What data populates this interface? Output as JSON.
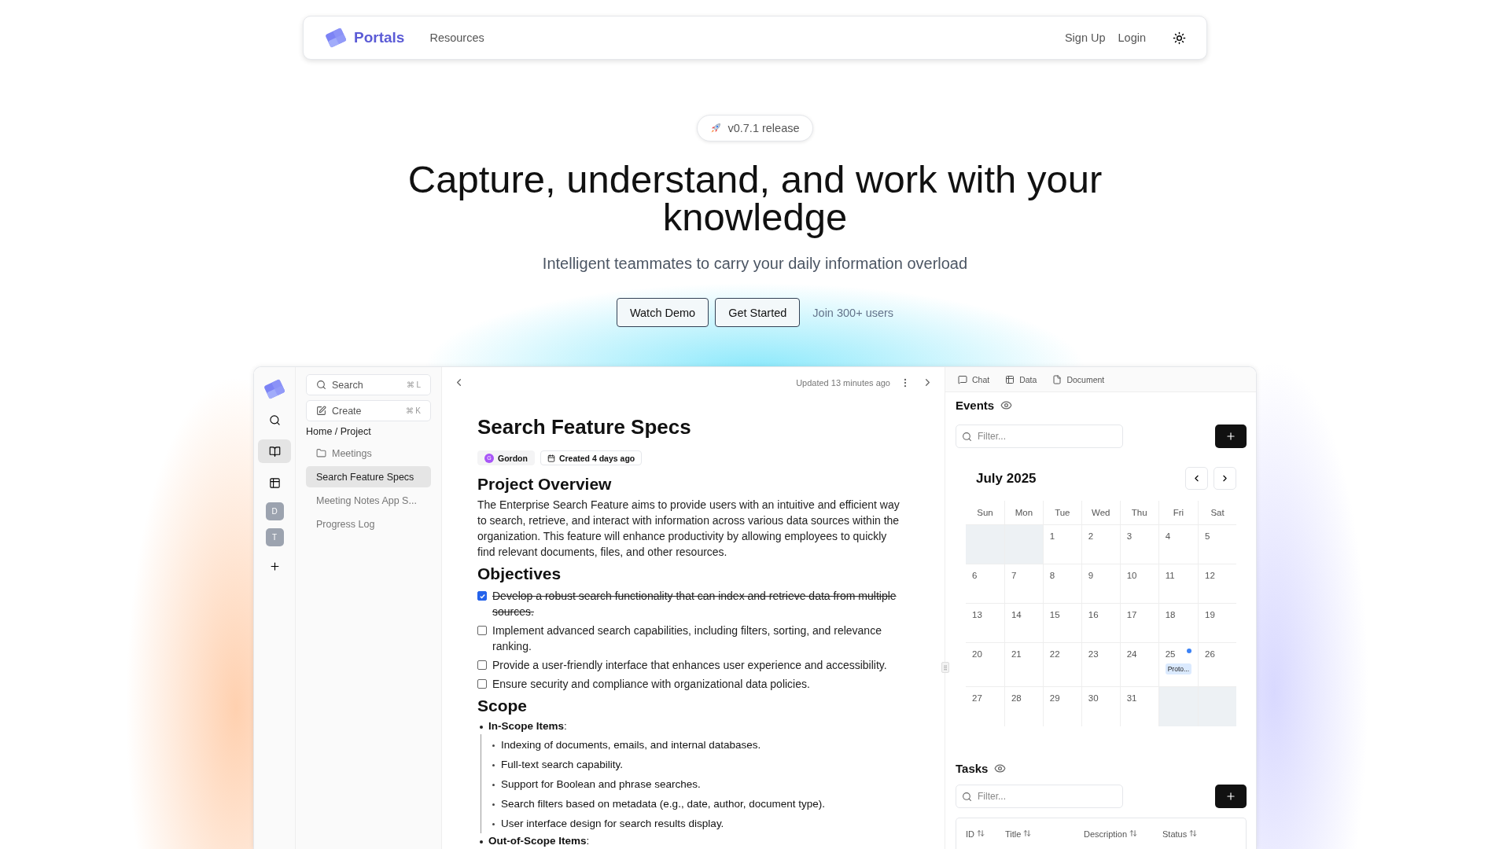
{
  "nav": {
    "brand": "Portals",
    "links": [
      {
        "label": "Resources"
      }
    ],
    "actions": [
      {
        "label": "Sign Up"
      },
      {
        "label": "Login"
      }
    ]
  },
  "hero": {
    "badge": "v0.7.1 release",
    "headline": "Capture, understand, and work with your knowledge",
    "subtitle": "Intelligent teammates to carry your daily information overload",
    "buttons": [
      {
        "label": "Watch Demo"
      },
      {
        "label": "Get Started"
      }
    ],
    "social_proof": "Join 300+ users"
  },
  "app": {
    "rail": [
      {
        "kind": "search",
        "selected": false
      },
      {
        "kind": "book",
        "selected": true
      },
      {
        "kind": "table",
        "selected": false
      },
      {
        "kind": "avatar",
        "label": "D",
        "selected": false
      },
      {
        "kind": "avatar",
        "label": "T",
        "selected": false
      },
      {
        "kind": "add",
        "selected": false
      }
    ],
    "sidebar": {
      "actions": [
        {
          "kind": "search",
          "label": "Search",
          "shortcut": "⌘ L"
        },
        {
          "kind": "create",
          "label": "Create",
          "shortcut": "⌘ K"
        }
      ],
      "breadcrumb": "Home / Project",
      "tree": [
        {
          "kind": "folder",
          "label": "Meetings",
          "selected": false
        },
        {
          "kind": "page",
          "label": "Search Feature Specs",
          "selected": true
        },
        {
          "kind": "page",
          "label": "Meeting Notes App S...",
          "selected": false
        },
        {
          "kind": "page",
          "label": "Progress Log",
          "selected": false
        }
      ]
    },
    "document": {
      "updated": "Updated 13 minutes ago",
      "title": "Search Feature Specs",
      "author": {
        "initial": "G",
        "name": "Gordon",
        "color": "#a855f7"
      },
      "created": "Created 4 days ago",
      "blocks": [
        {
          "kind": "heading",
          "text": "Project Overview"
        },
        {
          "kind": "paragraph",
          "text": "The Enterprise Search Feature aims to provide users with an intuitive and efficient way to search, retrieve, and interact with information across various data sources within the organization. This feature will enhance productivity by allowing employees to quickly find relevant documents, files, and other resources."
        },
        {
          "kind": "heading",
          "text": "Objectives"
        },
        {
          "kind": "todo",
          "text": "Develop a robust search functionality that can index and retrieve data from multiple sources.",
          "checked": true
        },
        {
          "kind": "todo",
          "text": "Implement advanced search capabilities, including filters, sorting, and relevance ranking.",
          "checked": false
        },
        {
          "kind": "todo",
          "text": "Provide a user-friendly interface that enhances user experience and accessibility.",
          "checked": false
        },
        {
          "kind": "todo",
          "text": "Ensure security and compliance with organizational data policies.",
          "checked": false
        },
        {
          "kind": "heading",
          "text": "Scope"
        },
        {
          "kind": "bullet",
          "text": "**In-Scope Items**:",
          "children": [
            {
              "text": "Indexing of documents, emails, and internal databases."
            },
            {
              "text": "Full-text search capability."
            },
            {
              "text": "Support for Boolean and phrase searches."
            },
            {
              "text": "Search filters based on metadata (e.g., date, author, document type)."
            },
            {
              "text": "User interface design for search results display."
            }
          ]
        },
        {
          "kind": "bullet",
          "text": "**Out-of-Scope Items**:"
        }
      ]
    },
    "panel": {
      "tabs": [
        {
          "kind": "chat",
          "label": "Chat"
        },
        {
          "kind": "data",
          "label": "Data"
        },
        {
          "kind": "document",
          "label": "Document"
        }
      ],
      "events": {
        "title": "Events",
        "filter_placeholder": "Filter...",
        "month": "July 2025",
        "weekdays": [
          "Sun",
          "Mon",
          "Tue",
          "Wed",
          "Thu",
          "Fri",
          "Sat"
        ],
        "weeks": [
          [
            {
              "outside": true
            },
            {
              "outside": true
            },
            {
              "day": "1"
            },
            {
              "day": "2"
            },
            {
              "day": "3"
            },
            {
              "day": "4"
            },
            {
              "day": "5"
            }
          ],
          [
            {
              "day": "6"
            },
            {
              "day": "7"
            },
            {
              "day": "8"
            },
            {
              "day": "9"
            },
            {
              "day": "10"
            },
            {
              "day": "11"
            },
            {
              "day": "12"
            }
          ],
          [
            {
              "day": "13"
            },
            {
              "day": "14"
            },
            {
              "day": "15"
            },
            {
              "day": "16"
            },
            {
              "day": "17"
            },
            {
              "day": "18"
            },
            {
              "day": "19"
            }
          ],
          [
            {
              "day": "20"
            },
            {
              "day": "21"
            },
            {
              "day": "22"
            },
            {
              "day": "23"
            },
            {
              "day": "24"
            },
            {
              "day": "25",
              "events": [
                {
                  "label": "Proto...",
                  "color": "#3b82f6"
                }
              ]
            },
            {
              "day": "26"
            }
          ],
          [
            {
              "day": "27"
            },
            {
              "day": "28"
            },
            {
              "day": "29"
            },
            {
              "day": "30"
            },
            {
              "day": "31"
            },
            {
              "outside": true
            },
            {
              "outside": true
            }
          ]
        ]
      },
      "tasks": {
        "title": "Tasks",
        "filter_placeholder": "Filter...",
        "columns": [
          {
            "label": "ID"
          },
          {
            "label": "Title"
          },
          {
            "label": "Description"
          },
          {
            "label": "Status"
          }
        ]
      }
    }
  }
}
